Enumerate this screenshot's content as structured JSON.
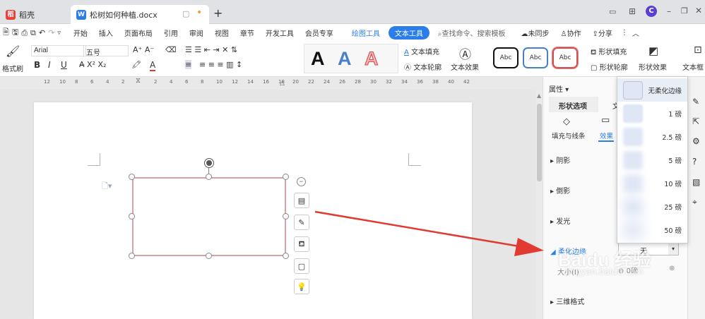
{
  "titlebar": {
    "tabs": [
      {
        "label": "稻壳",
        "icon": "docer-logo-icon",
        "color": "#e8403a"
      },
      {
        "label": "松树如何种植.docx",
        "icon": "word-doc-icon",
        "color": "#2b7de9"
      }
    ],
    "avatar_letter": "C"
  },
  "menu": {
    "items": [
      "开始",
      "插入",
      "页面布局",
      "引用",
      "审阅",
      "视图",
      "章节",
      "开发工具",
      "会员专享"
    ],
    "drawing_tool": "绘图工具",
    "text_tool": "文本工具",
    "search_placeholder": "查找命令、搜索模板",
    "unsynced": "未同步",
    "collab": "协作",
    "share": "分享"
  },
  "ribbon": {
    "format_painter": "格式刷",
    "font_name": "Arial",
    "font_size": "五号",
    "bold": "B",
    "italic": "I",
    "underline": "U",
    "text_fill": "文本填充",
    "text_outline": "文本轮廓",
    "text_effect": "文本效果",
    "big_a": "A",
    "abc": "Abc",
    "shape_fill": "形状填充",
    "shape_outline": "形状轮廓",
    "shape_effect": "形状效果",
    "text_box": "文本框"
  },
  "ruler": {
    "numbers": [
      "12",
      "10",
      "8",
      "6",
      "4",
      "2",
      "2",
      "4",
      "6",
      "8",
      "10",
      "12",
      "14",
      "16",
      "18",
      "20",
      "22",
      "24",
      "26",
      "28",
      "30",
      "32",
      "34",
      "36",
      "38",
      "40",
      "42"
    ]
  },
  "panel": {
    "title": "属性",
    "tab_shape": "形状选项",
    "tab_text": "文",
    "sub_fill": "填充与线条",
    "sub_effect": "效果",
    "sections": [
      "阴影",
      "倒影",
      "发光"
    ],
    "soft_edge": "柔化边缘",
    "soft_edge_value": "无",
    "size_label": "大小(I)",
    "size_value": "0磅",
    "three_d": "三维格式"
  },
  "soft_edge_options": [
    "无柔化边缘",
    "1 磅",
    "2.5 磅",
    "5 磅",
    "10 磅",
    "25 磅",
    "50 磅"
  ],
  "watermark": {
    "text": "Baidu 经验",
    "url": "jingyan.baidu.com"
  },
  "colors": {
    "accent": "#2b7de9",
    "arrow": "#e03a32",
    "shape_border": "#d9a0a5"
  }
}
